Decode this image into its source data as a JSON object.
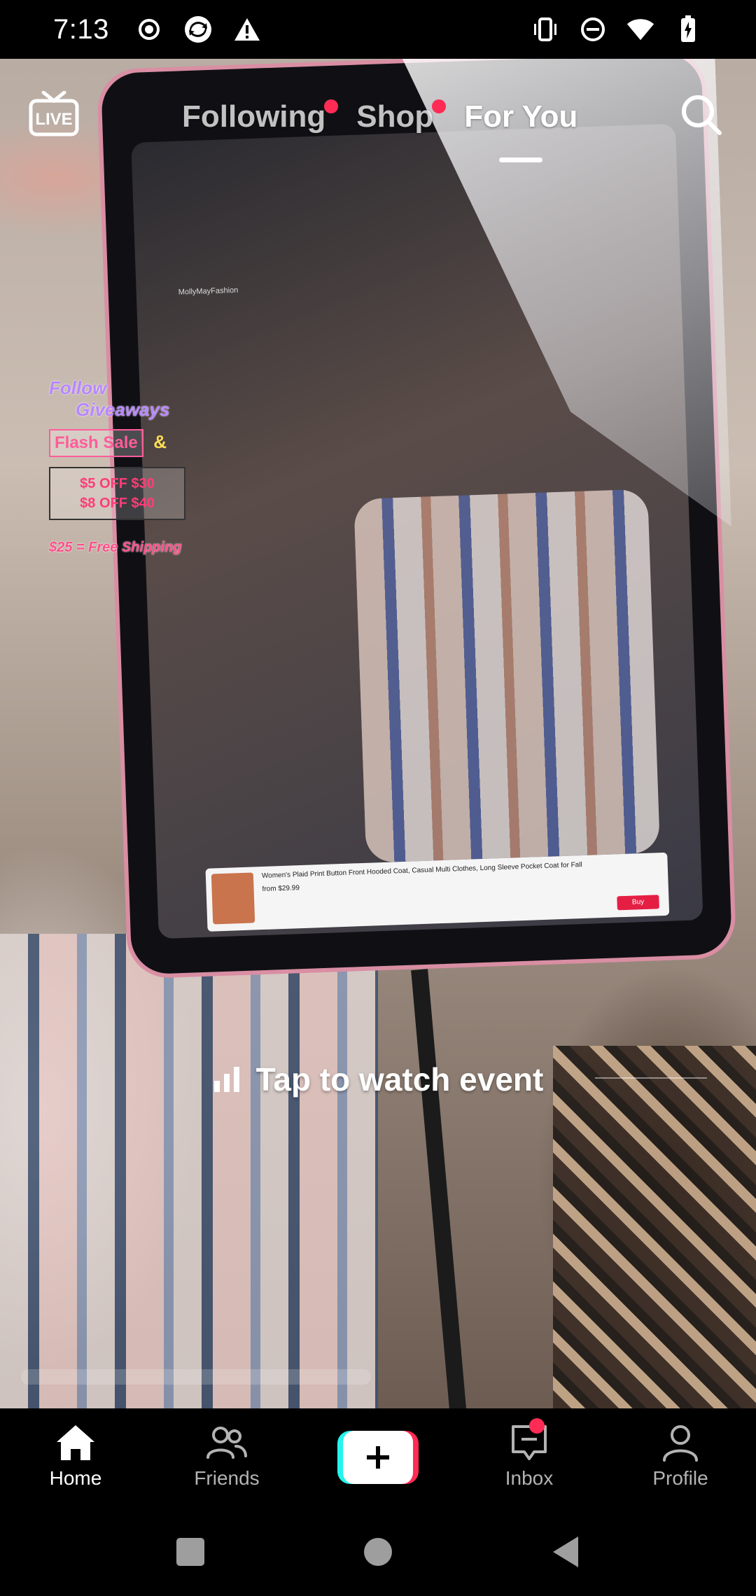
{
  "status_bar": {
    "time": "7:13",
    "left_icons": [
      "record-icon",
      "sync-app-icon",
      "warning-icon"
    ],
    "right_icons": [
      "vibrate-icon",
      "do-not-disturb-icon",
      "wifi-icon",
      "battery-icon"
    ]
  },
  "top_nav": {
    "live_label": "LIVE",
    "tabs": [
      {
        "label": "Following",
        "has_dot": true,
        "active": false
      },
      {
        "label": "Shop",
        "has_dot": true,
        "active": false
      },
      {
        "label": "For You",
        "has_dot": false,
        "active": true
      }
    ]
  },
  "video": {
    "promo": {
      "follow": "Follow",
      "giveaways": "Giveaways",
      "flash_sale": "Flash Sale",
      "amp": "&",
      "discount_1": "$5 OFF $30",
      "discount_2": "$8 OFF $40",
      "shipping": "$25 = Free Shipping"
    },
    "tablet_screen": {
      "username": "MollyMayFashion",
      "product_title": "Women's Plaid Print Button Front Hooded Coat, Casual Multi Clothes, Long Sleeve Pocket Coat for Fall",
      "product_price": "from $29.99",
      "buy_label": "Buy"
    },
    "tap_to_watch": "Tap to watch event"
  },
  "bottom_nav": {
    "items": [
      {
        "label": "Home",
        "icon": "home-icon",
        "active": true
      },
      {
        "label": "Friends",
        "icon": "friends-icon",
        "active": false
      },
      {
        "label": "",
        "icon": "plus-icon",
        "active": false
      },
      {
        "label": "Inbox",
        "icon": "inbox-icon",
        "active": false,
        "has_dot": true
      },
      {
        "label": "Profile",
        "icon": "profile-icon",
        "active": false
      }
    ]
  },
  "colors": {
    "accent_red": "#fe2c55",
    "accent_cyan": "#25f4ee"
  }
}
